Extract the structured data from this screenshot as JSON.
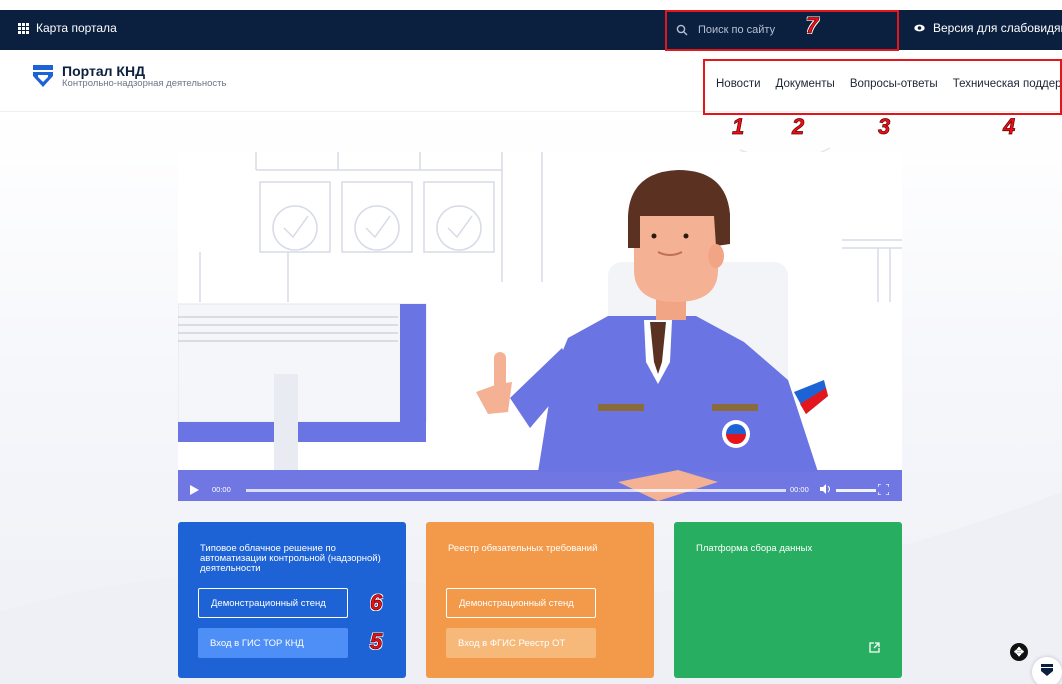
{
  "topbar": {
    "portal_map": "Карта портала",
    "search_placeholder": "Поиск по сайту",
    "low_vision": "Версия для слабовидящих"
  },
  "header": {
    "logo_title": "Портал КНД",
    "logo_subtitle": "Контрольно-надзорная деятельность",
    "nav": [
      "Новости",
      "Документы",
      "Вопросы-ответы",
      "Техническая поддержка"
    ]
  },
  "video": {
    "current_time": "00:00",
    "duration": "00:00"
  },
  "cards": [
    {
      "title": "Типовое облачное решение по автоматизации контрольной (надзорной) деятельности",
      "buttons": [
        "Демонстрационный стенд",
        "Вход в ГИС ТОР КНД"
      ]
    },
    {
      "title": "Реестр обязательных требований",
      "buttons": [
        "Демонстрационный стенд",
        "Вход в ФГИС Реестр ОТ"
      ]
    },
    {
      "title": "Платформа сбора данных",
      "buttons": []
    }
  ],
  "annotations": [
    "1",
    "2",
    "3",
    "4",
    "5",
    "6",
    "7"
  ],
  "colors": {
    "topbar": "#0b1f3f",
    "card_blue": "#1e63d6",
    "card_orange": "#f2994a",
    "card_green": "#27ae60",
    "highlight": "#e3161b"
  }
}
